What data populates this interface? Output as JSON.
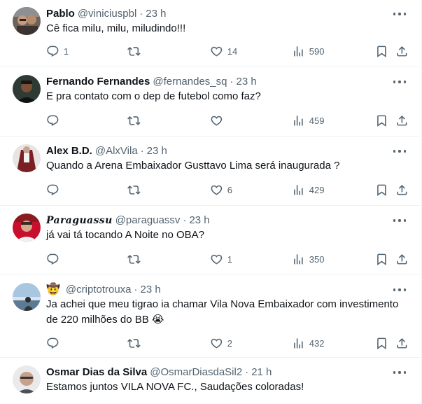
{
  "tweets": [
    {
      "name": "Pablo",
      "handle": "@viniciuspbl",
      "time": "23 h",
      "text": "Cê fica milu, milu, miludindo!!!",
      "replies": "1",
      "retweets": "",
      "likes": "14",
      "views": "590"
    },
    {
      "name": "Fernando Fernandes",
      "handle": "@fernandes_sq",
      "time": "23 h",
      "text": "E pra contato com o dep de futebol como faz?",
      "replies": "",
      "retweets": "",
      "likes": "",
      "views": "459"
    },
    {
      "name": "Alex B.D.",
      "handle": "@AlxVila",
      "time": "23 h",
      "text": "Quando a Arena Embaixador Gusttavo Lima será inaugurada ?",
      "replies": "",
      "retweets": "",
      "likes": "6",
      "views": "429"
    },
    {
      "name": "Paraguassu",
      "handle": "@paraguassv",
      "time": "23 h",
      "text": "já vai tá tocando A Noite no OBA?",
      "replies": "",
      "retweets": "",
      "likes": "1",
      "views": "350"
    },
    {
      "name_emoji": "🤠",
      "handle": "@criptotrouxa",
      "time": "23 h",
      "text": "Ja achei que meu tigrao ia chamar Vila Nova Embaixador com investimento de 220 milhões do BB 😭",
      "replies": "",
      "retweets": "",
      "likes": "2",
      "views": "432"
    },
    {
      "name": "Osmar Dias da Silva",
      "handle": "@OsmarDiasdaSil2",
      "time": "21 h",
      "text": "Estamos juntos VILA NOVA FC., Saudações coloradas!"
    }
  ],
  "separator": "·",
  "icons": {
    "reply": "reply-icon",
    "retweet": "retweet-icon",
    "like": "heart-icon",
    "views": "views-bar-chart-icon",
    "bookmark": "bookmark-icon",
    "share": "share-icon",
    "more": "more-options-icon"
  },
  "colors": {
    "text_primary": "#0f1419",
    "text_secondary": "#536471",
    "divider": "#eff3f4",
    "background": "#ffffff"
  }
}
